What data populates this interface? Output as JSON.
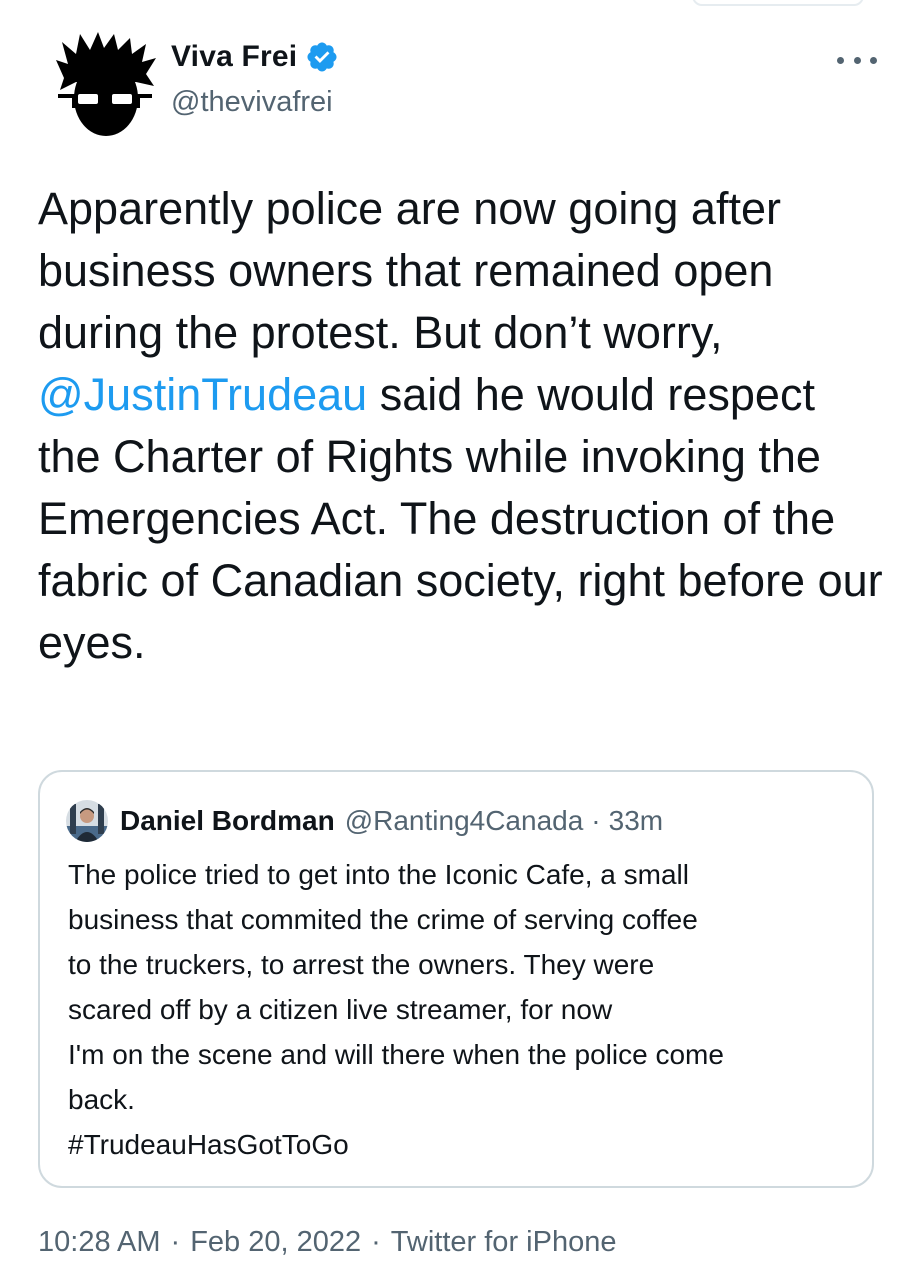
{
  "author": {
    "display_name": "Viva Frei",
    "handle": "@thevivafrei",
    "verified": true,
    "avatar_icon": "spiky-hair-sunglasses-avatar"
  },
  "tweet": {
    "text_before_mention": "Apparently police are now going after business owners that remained open during the protest. But don’t worry, ",
    "mention": "@JustinTrudeau",
    "text_after_mention": " said he would respect the Charter of Rights while invoking the Emergencies Act. The destruction of the fabric of Canadian society, right before our eyes."
  },
  "quoted_tweet": {
    "display_name": "Daniel Bordman",
    "handle": "@Ranting4Canada",
    "separator": "·",
    "time": "33m",
    "lines": [
      "The police tried to get into the Iconic Cafe, a small",
      "business that commited the crime of serving coffee",
      "to the truckers, to arrest the owners. They were",
      "scared off by a citizen live streamer, for now",
      "I'm on the scene and will there when the police come",
      "back.",
      "#TrudeauHasGotToGo"
    ]
  },
  "meta": {
    "time": "10:28 AM",
    "separator1": "·",
    "date": "Feb 20, 2022",
    "separator2": "·",
    "source": "Twitter for iPhone"
  },
  "colors": {
    "link": "#1d9bf0",
    "secondary_text": "#536471",
    "primary_text": "#0f1419",
    "border": "#cfd9de"
  }
}
